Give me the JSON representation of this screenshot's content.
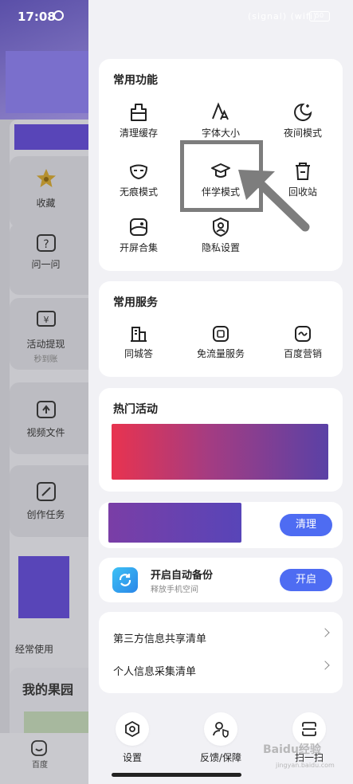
{
  "status_bar": {
    "time": "17:08",
    "right_icons": "(signal) (wifi)",
    "battery": "50"
  },
  "background_app": {
    "side_items": [
      {
        "label": "收藏",
        "sub": "",
        "icon": "star-icon"
      },
      {
        "label": "问一问",
        "sub": "",
        "icon": "question-icon"
      },
      {
        "label": "活动提现",
        "sub": "秒到账",
        "icon": "yuan-icon"
      },
      {
        "label": "视频文件",
        "sub": "",
        "icon": "video-icon"
      },
      {
        "label": "创作任务",
        "sub": "",
        "icon": "edit-icon"
      }
    ],
    "often_used": "经常使用",
    "orchard": "我的果园",
    "bottom_nav_label": "百度"
  },
  "common_functions": {
    "title": "常用功能",
    "items": [
      {
        "label": "清理缓存",
        "icon": "broom-icon"
      },
      {
        "label": "字体大小",
        "icon": "font-size-icon"
      },
      {
        "label": "夜间模式",
        "icon": "moon-icon"
      },
      {
        "label": "无痕模式",
        "icon": "mask-icon"
      },
      {
        "label": "伴学模式",
        "icon": "graduation-cap-icon"
      },
      {
        "label": "回收站",
        "icon": "trash-icon"
      },
      {
        "label": "开屏合集",
        "icon": "image-icon"
      },
      {
        "label": "隐私设置",
        "icon": "shield-user-icon"
      }
    ]
  },
  "common_services": {
    "title": "常用服务",
    "items": [
      {
        "label": "同城答",
        "icon": "building-icon"
      },
      {
        "label": "免流量服务",
        "icon": "sim-card-icon"
      },
      {
        "label": "百度营销",
        "icon": "chart-wave-icon"
      }
    ]
  },
  "hot_activities": {
    "title": "热门活动"
  },
  "clean_card": {
    "button": "清理"
  },
  "backup_card": {
    "title": "开启自动备份",
    "subtitle": "释放手机空间",
    "button": "开启"
  },
  "links": [
    {
      "label": "第三方信息共享清单"
    },
    {
      "label": "个人信息采集清单"
    }
  ],
  "bottom_buttons": [
    {
      "label": "设置",
      "icon": "settings-icon"
    },
    {
      "label": "反馈/保障",
      "icon": "feedback-icon"
    },
    {
      "label": "扫一扫",
      "icon": "scan-icon"
    }
  ],
  "watermark": "Baidu经验",
  "watermark_url": "jingyan.baidu.com",
  "colors": {
    "accent": "#4e6cf2",
    "drawer_bg": "#f1f1f5",
    "highlight_border": "#7d7d7d"
  }
}
